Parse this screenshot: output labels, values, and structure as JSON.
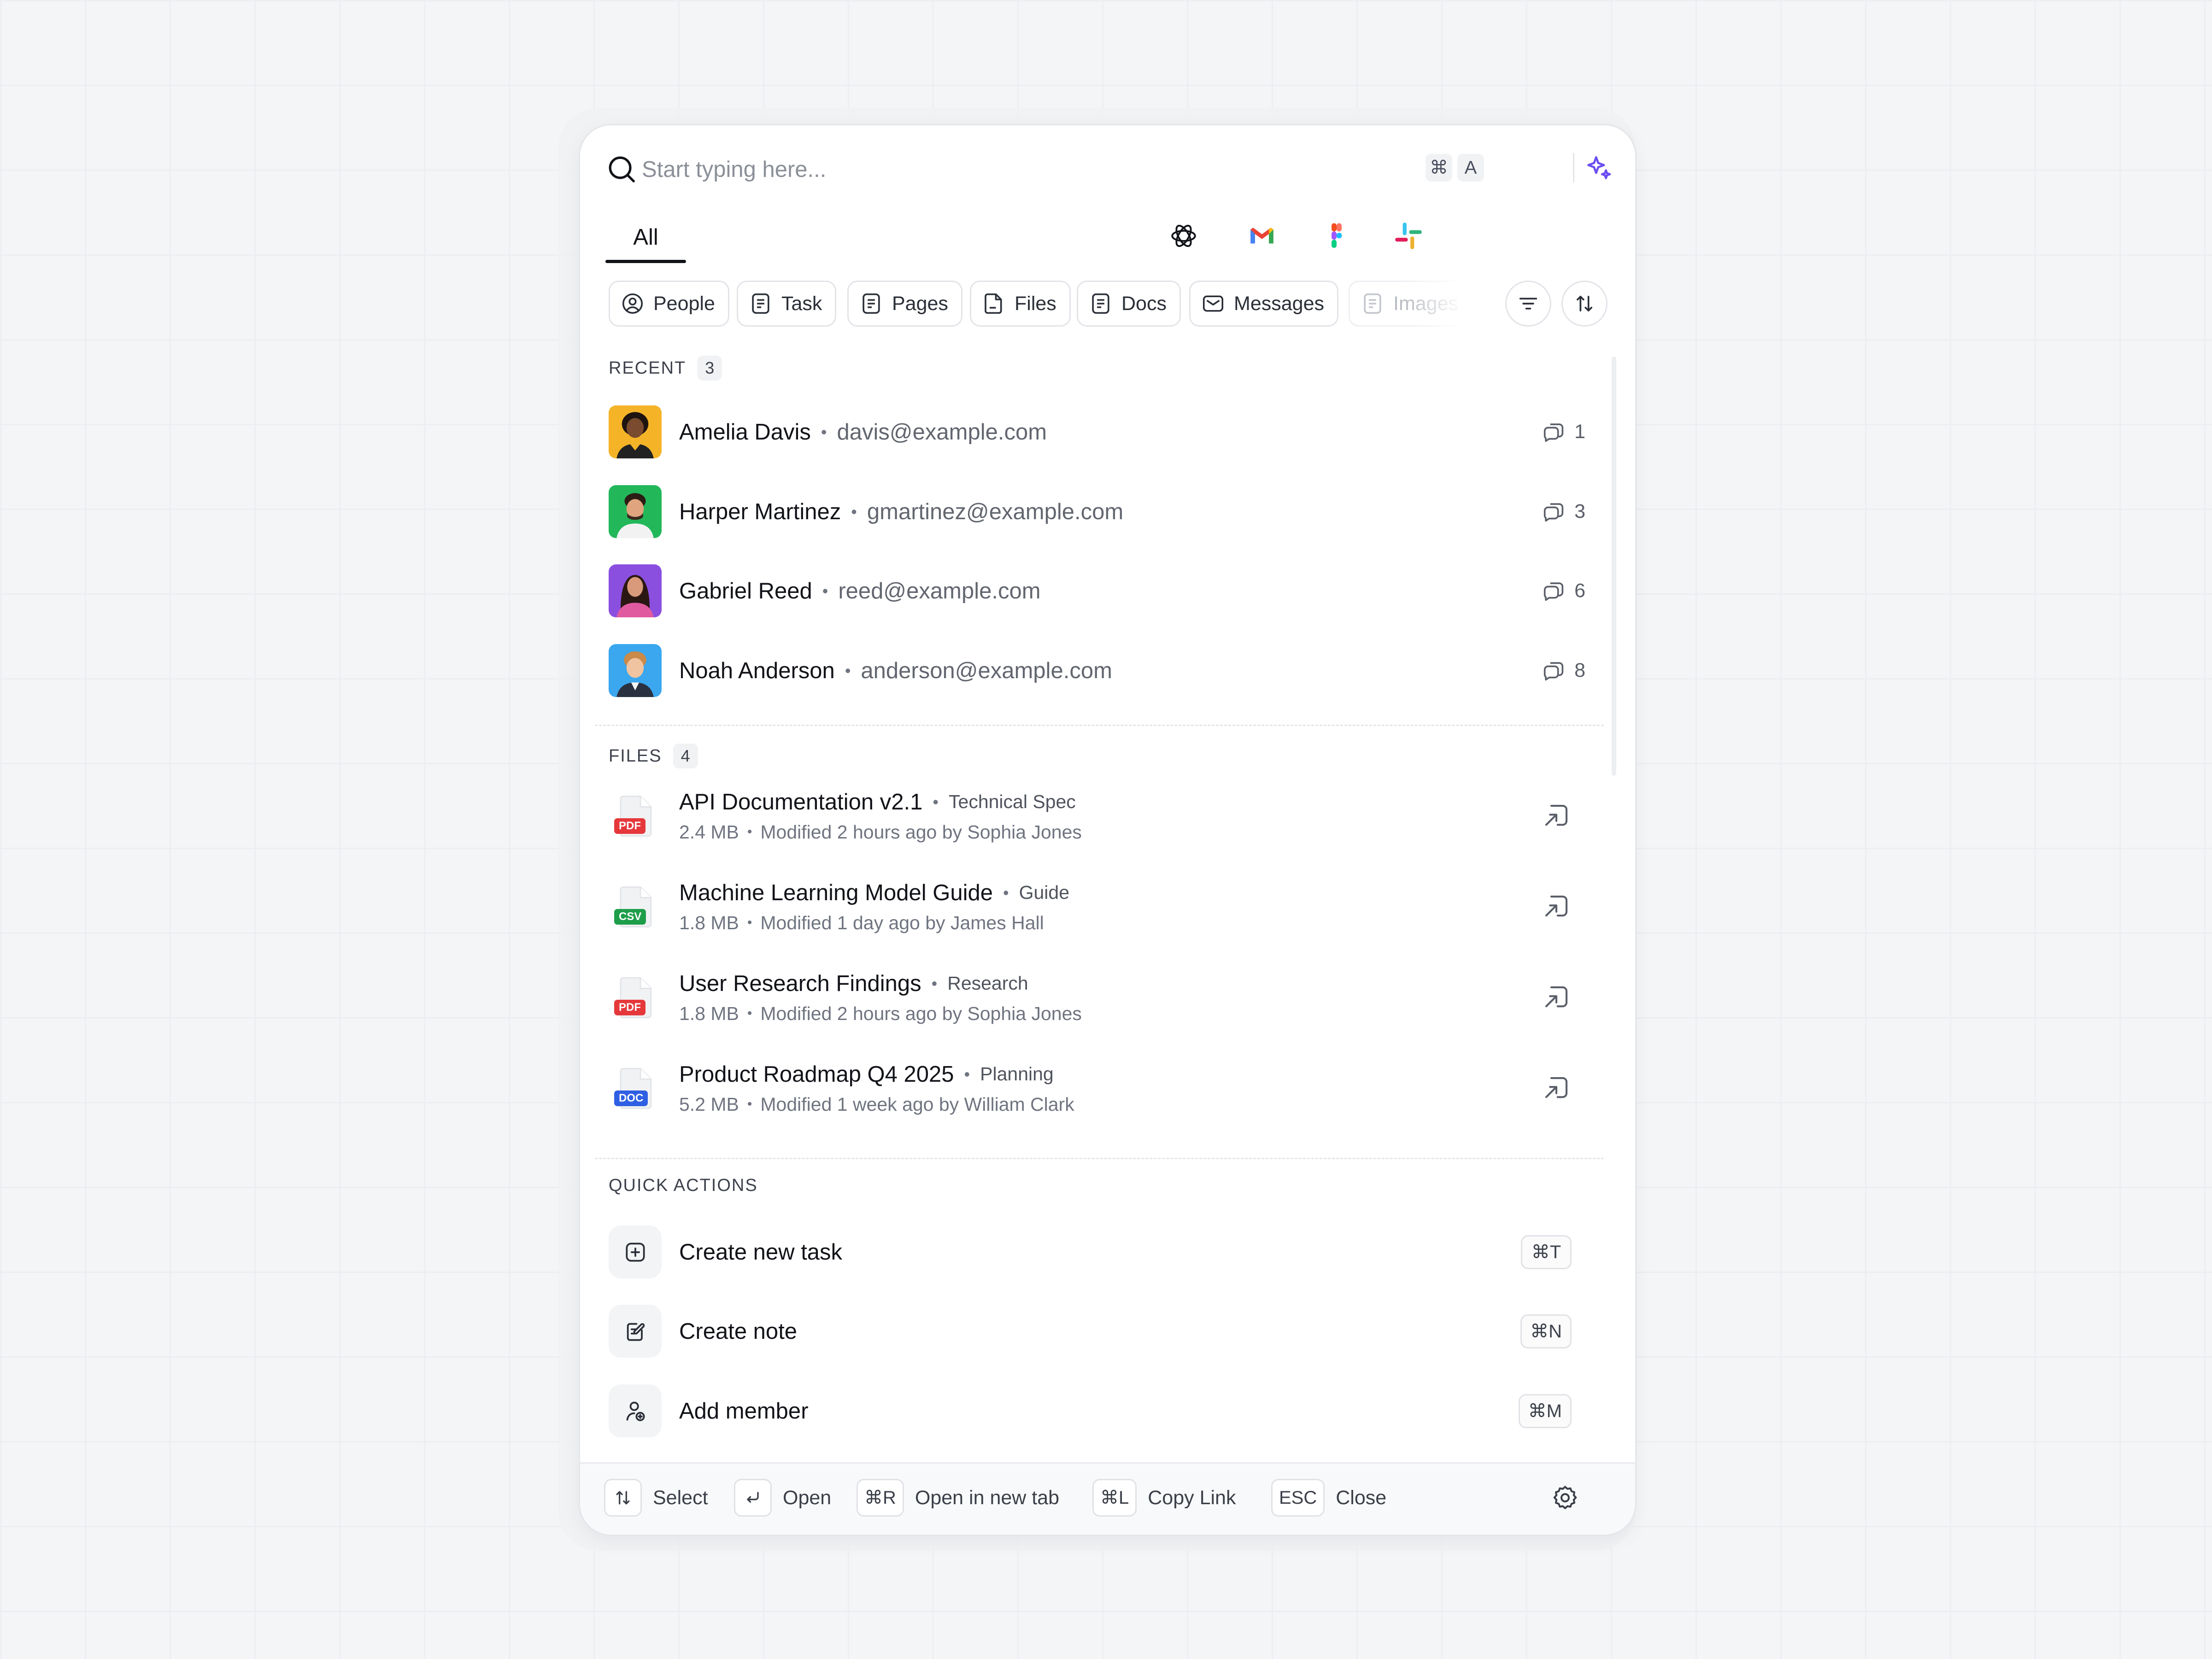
{
  "search": {
    "placeholder": "Start typing here...",
    "shortcut_cmd": "⌘",
    "shortcut_key": "A"
  },
  "tabs": {
    "active": "All",
    "apps": [
      "openai-icon",
      "gmail-icon",
      "figma-icon",
      "slack-icon",
      "shopify-icon",
      "zapier-icon",
      "zendesk-icon",
      "google-drive-icon",
      "linear-icon",
      "asterisk-app-icon"
    ]
  },
  "filters": [
    {
      "label": "People",
      "icon": "person-icon"
    },
    {
      "label": "Task",
      "icon": "document-icon"
    },
    {
      "label": "Pages",
      "icon": "document-icon"
    },
    {
      "label": "Files",
      "icon": "file-icon"
    },
    {
      "label": "Docs",
      "icon": "document-icon"
    },
    {
      "label": "Messages",
      "icon": "mail-icon"
    },
    {
      "label": "Images",
      "icon": "document-icon"
    }
  ],
  "recent": {
    "label": "RECENT",
    "count": "3",
    "people": [
      {
        "name": "Amelia Davis",
        "email": "davis@example.com",
        "messages": "1",
        "avatar_color": "#f5b428"
      },
      {
        "name": "Harper Martinez",
        "email": "gmartinez@example.com",
        "messages": "3",
        "avatar_color": "#22b85a"
      },
      {
        "name": "Gabriel Reed",
        "email": "reed@example.com",
        "messages": "6",
        "avatar_color": "#8b4fe0"
      },
      {
        "name": "Noah Anderson",
        "email": "anderson@example.com",
        "messages": "8",
        "avatar_color": "#3aa7ef"
      }
    ]
  },
  "files": {
    "label": "FILES",
    "count": "4",
    "items": [
      {
        "title": "API Documentation v2.1",
        "category": "Technical Spec",
        "size": "2.4 MB",
        "modified": "Modified 2 hours ago by Sophia Jones",
        "type": "PDF",
        "badge_color": "#e5383b"
      },
      {
        "title": "Machine Learning Model Guide",
        "category": "Guide",
        "size": "1.8 MB",
        "modified": "Modified 1 day ago by James Hall",
        "type": "CSV",
        "badge_color": "#1e9e4a"
      },
      {
        "title": "User Research Findings",
        "category": "Research",
        "size": "1.8 MB",
        "modified": "Modified 2 hours ago by Sophia Jones",
        "type": "PDF",
        "badge_color": "#e5383b"
      },
      {
        "title": "Product Roadmap Q4 2025",
        "category": "Planning",
        "size": "5.2 MB",
        "modified": "Modified 1 week ago by William Clark",
        "type": "DOC",
        "badge_color": "#2f5fe3"
      }
    ]
  },
  "quick_actions": {
    "label": "QUICK ACTIONS",
    "items": [
      {
        "label": "Create new task",
        "shortcut": "⌘T",
        "icon": "plus-square-icon"
      },
      {
        "label": "Create note",
        "shortcut": "⌘N",
        "icon": "note-edit-icon"
      },
      {
        "label": "Add member",
        "shortcut": "⌘M",
        "icon": "add-member-icon"
      }
    ]
  },
  "footer": {
    "select_label": "Select",
    "open_label": "Open",
    "new_tab_key": "⌘R",
    "new_tab_label": "Open in new tab",
    "copy_key": "⌘L",
    "copy_label": "Copy Link",
    "close_key": "ESC",
    "close_label": "Close"
  },
  "colors": {
    "accent": "#111318",
    "sparkle": "#6b4df0",
    "grid": "#eceef1"
  }
}
